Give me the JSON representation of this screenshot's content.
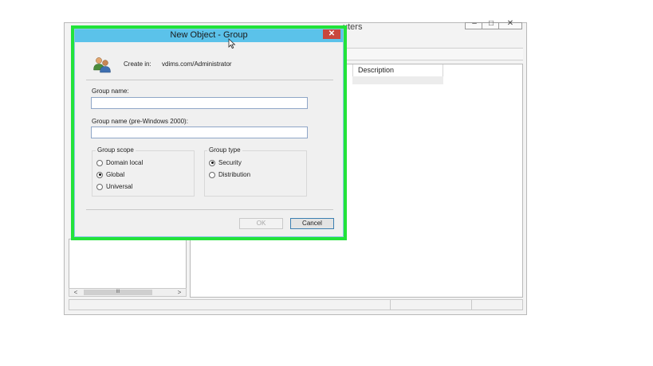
{
  "background_window": {
    "title_fragment": "uters",
    "controls": {
      "minimize": "–",
      "maximize": "□",
      "close": "✕"
    },
    "columns": [
      "Description"
    ],
    "scroll": {
      "left": "<",
      "thumb": "III",
      "right": ">"
    }
  },
  "dialog": {
    "title": "New Object - Group",
    "close_glyph": "✕",
    "create_in_label": "Create in:",
    "create_in_value": "vdims.com/Administrator",
    "group_name_label": "Group name:",
    "group_name_value": "",
    "group_name_pre2000_label": "Group name (pre-Windows 2000):",
    "group_name_pre2000_value": "",
    "group_scope": {
      "title": "Group scope",
      "options": [
        {
          "label": "Domain local",
          "checked": false
        },
        {
          "label": "Global",
          "checked": true
        },
        {
          "label": "Universal",
          "checked": false
        }
      ]
    },
    "group_type": {
      "title": "Group type",
      "options": [
        {
          "label": "Security",
          "checked": true
        },
        {
          "label": "Distribution",
          "checked": false
        }
      ]
    },
    "buttons": {
      "ok": "OK",
      "cancel": "Cancel",
      "ok_enabled": false
    }
  },
  "colors": {
    "title_bar": "#5bc2ea",
    "close_button": "#c9473d",
    "highlight_frame": "#22e33a",
    "dialog_background": "#f0f0f0"
  },
  "icons": {
    "create_in": "users-icon",
    "cursor": "mouse-pointer-icon"
  }
}
